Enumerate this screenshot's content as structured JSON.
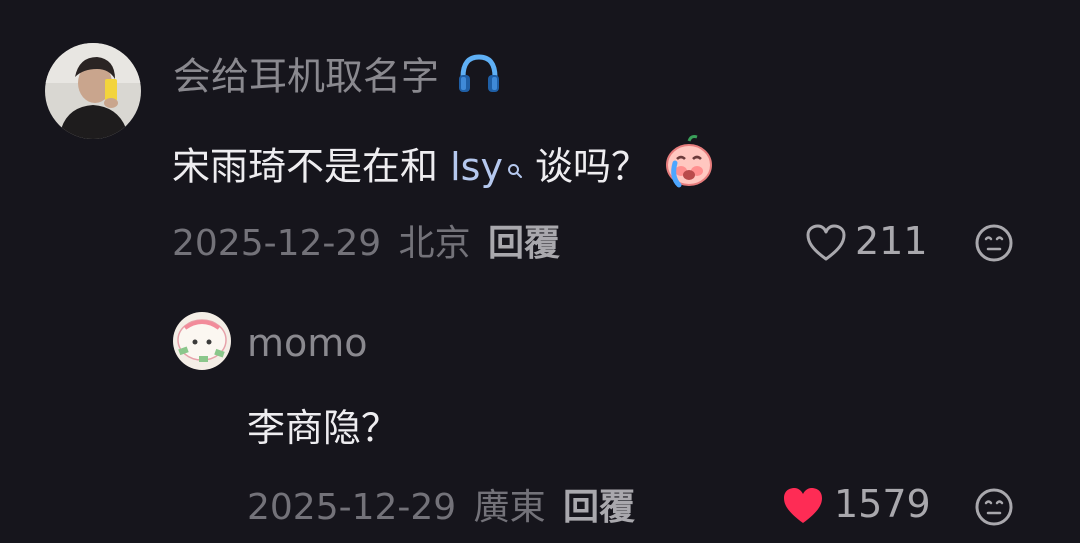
{
  "comment": {
    "username": "会给耳机取名字",
    "username_emoji_icon": "headphones-icon",
    "text_prefix": "宋雨琦不是在和 ",
    "mention": "lsy",
    "text_suffix": " 谈吗？",
    "text_emoji_icon": "crying-face-icon",
    "date": "2025-12-29",
    "location": "北京",
    "reply_label": "回覆",
    "likes": "211",
    "liked": false,
    "accent_like": "#ff3b5c"
  },
  "reply": {
    "username": "momo",
    "text": "李商隐？",
    "date": "2025-12-29",
    "location": "廣東",
    "reply_label": "回覆",
    "likes": "1579",
    "liked": true,
    "like_color": "#fe2c55"
  }
}
